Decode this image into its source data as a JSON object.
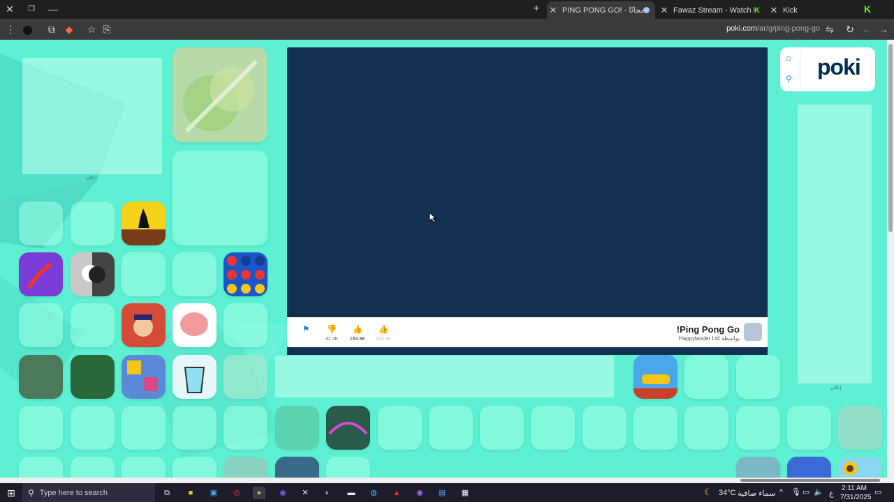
{
  "browser": {
    "tabs": [
      {
        "title": "PING PONG GO! - الإنترنت مجانًا",
        "active": true
      },
      {
        "title": "Fawaz Stream - Watch Live on Kick",
        "active": false
      },
      {
        "title": "Kick",
        "active": false
      }
    ],
    "new_tab": "+",
    "url_host": "poki.com",
    "url_path": "/ar/g/ping-pong-go"
  },
  "poki": {
    "logo": "poki",
    "ad_label": "إعلان"
  },
  "game": {
    "title": "!Ping Pong Go",
    "developer": "Happylander Ltd بواسطة",
    "likes": "42.4K",
    "dislikes": "153.5K",
    "third": "153.5K"
  },
  "taskbar": {
    "search_placeholder": "Type here to search",
    "weather_temp": "34°C",
    "weather_text": "سماء صافية",
    "lang": "ع",
    "time": "2:11 AM",
    "date": "7/31/2025"
  },
  "colors": {
    "background": "#5ef0d2",
    "game_bg": "#12304f",
    "accent": "#1e88e5"
  }
}
